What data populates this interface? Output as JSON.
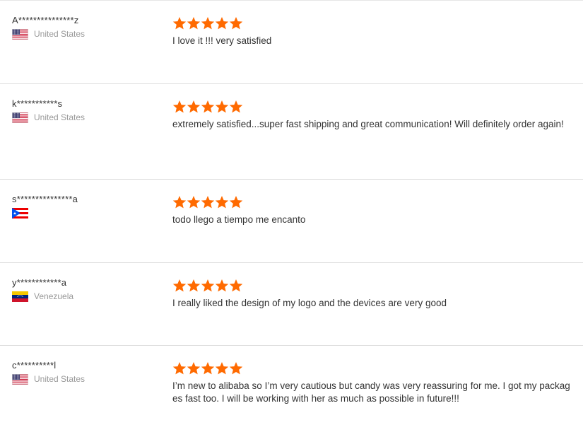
{
  "colors": {
    "star": "#ff6a00",
    "divider": "#dcdcdc",
    "country_text": "#999999"
  },
  "reviews": [
    {
      "buyer": "A***************z",
      "country": "United States",
      "flag_icon": "flag-us-icon",
      "rating": 5,
      "text": "I love it !!! very satisfied"
    },
    {
      "buyer": "k***********s",
      "country": "United States",
      "flag_icon": "flag-us-icon",
      "rating": 5,
      "text": "extremely satisfied...super fast shipping and great communication!  Will definitely order again!"
    },
    {
      "buyer": "s***************a",
      "country": "",
      "flag_icon": "flag-pr-icon",
      "rating": 5,
      "text": "todo llego a tiempo me encanto"
    },
    {
      "buyer": "y************a",
      "country": "Venezuela",
      "flag_icon": "flag-ve-icon",
      "rating": 5,
      "text": "I really liked the design of my logo and the devices are very good"
    },
    {
      "buyer": "c**********l",
      "country": "United States",
      "flag_icon": "flag-us-icon",
      "rating": 5,
      "text": "I’m new to alibaba so I’m very cautious but candy was very reassuring for me. I got my packages fast too. I will be working with her as much as possible in future!!!"
    }
  ]
}
